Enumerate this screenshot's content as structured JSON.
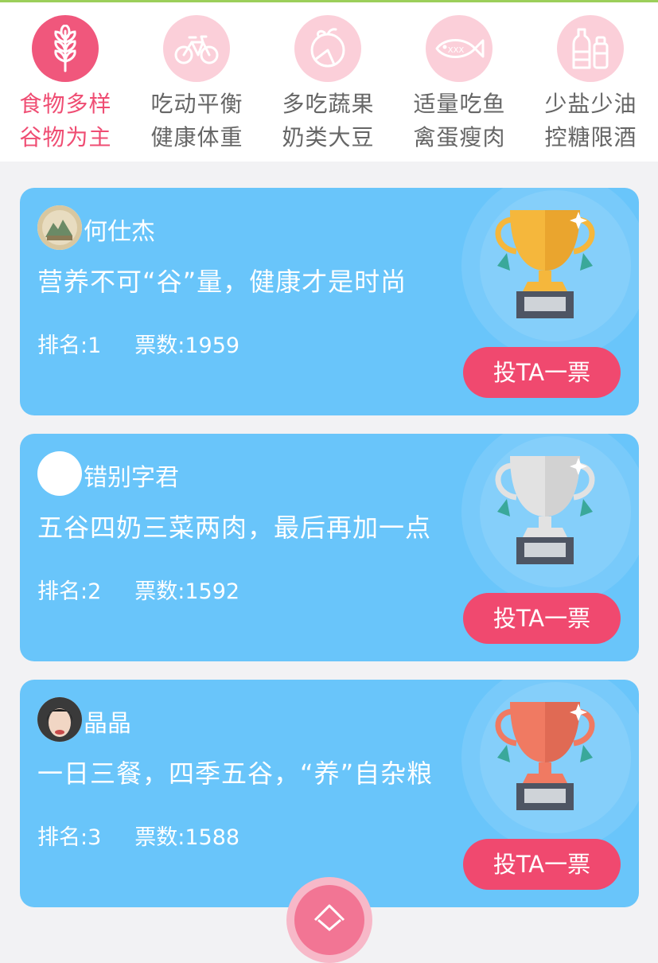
{
  "nav": {
    "items": [
      {
        "line1": "食物多样",
        "line2": "谷物为主",
        "icon": "wheat-icon",
        "active": true
      },
      {
        "line1": "吃动平衡",
        "line2": "健康体重",
        "icon": "bicycle-icon",
        "active": false
      },
      {
        "line1": "多吃蔬果",
        "line2": "奶类大豆",
        "icon": "fruit-icon",
        "active": false
      },
      {
        "line1": "适量吃鱼",
        "line2": "禽蛋瘦肉",
        "icon": "fish-icon",
        "active": false
      },
      {
        "line1": "少盐少油",
        "line2": "控糖限酒",
        "icon": "bottles-icon",
        "active": false
      }
    ],
    "fish_text": "XXX"
  },
  "entries": [
    {
      "name": "何仕杰",
      "slogan": "营养不可“谷”量，健康才是时尚",
      "rank_label": "排名:1",
      "votes_label": "票数:1959",
      "vote_button": "投TA一票",
      "trophy": "gold-trophy-icon"
    },
    {
      "name": "错别字君",
      "slogan": "五谷四奶三菜两肉，最后再加一点",
      "rank_label": "排名:2",
      "votes_label": "票数:1592",
      "vote_button": "投TA一票",
      "trophy": "silver-trophy-icon"
    },
    {
      "name": "晶晶",
      "slogan": "一日三餐，四季五谷，“养”自杂粮",
      "rank_label": "排名:3",
      "votes_label": "票数:1588",
      "vote_button": "投TA一票",
      "trophy": "bronze-trophy-icon"
    }
  ],
  "colors": {
    "accent": "#f0496f",
    "card": "#69c5fa",
    "gold": "#f5b73c",
    "silver": "#e2e2e2",
    "bronze": "#f07a62"
  }
}
